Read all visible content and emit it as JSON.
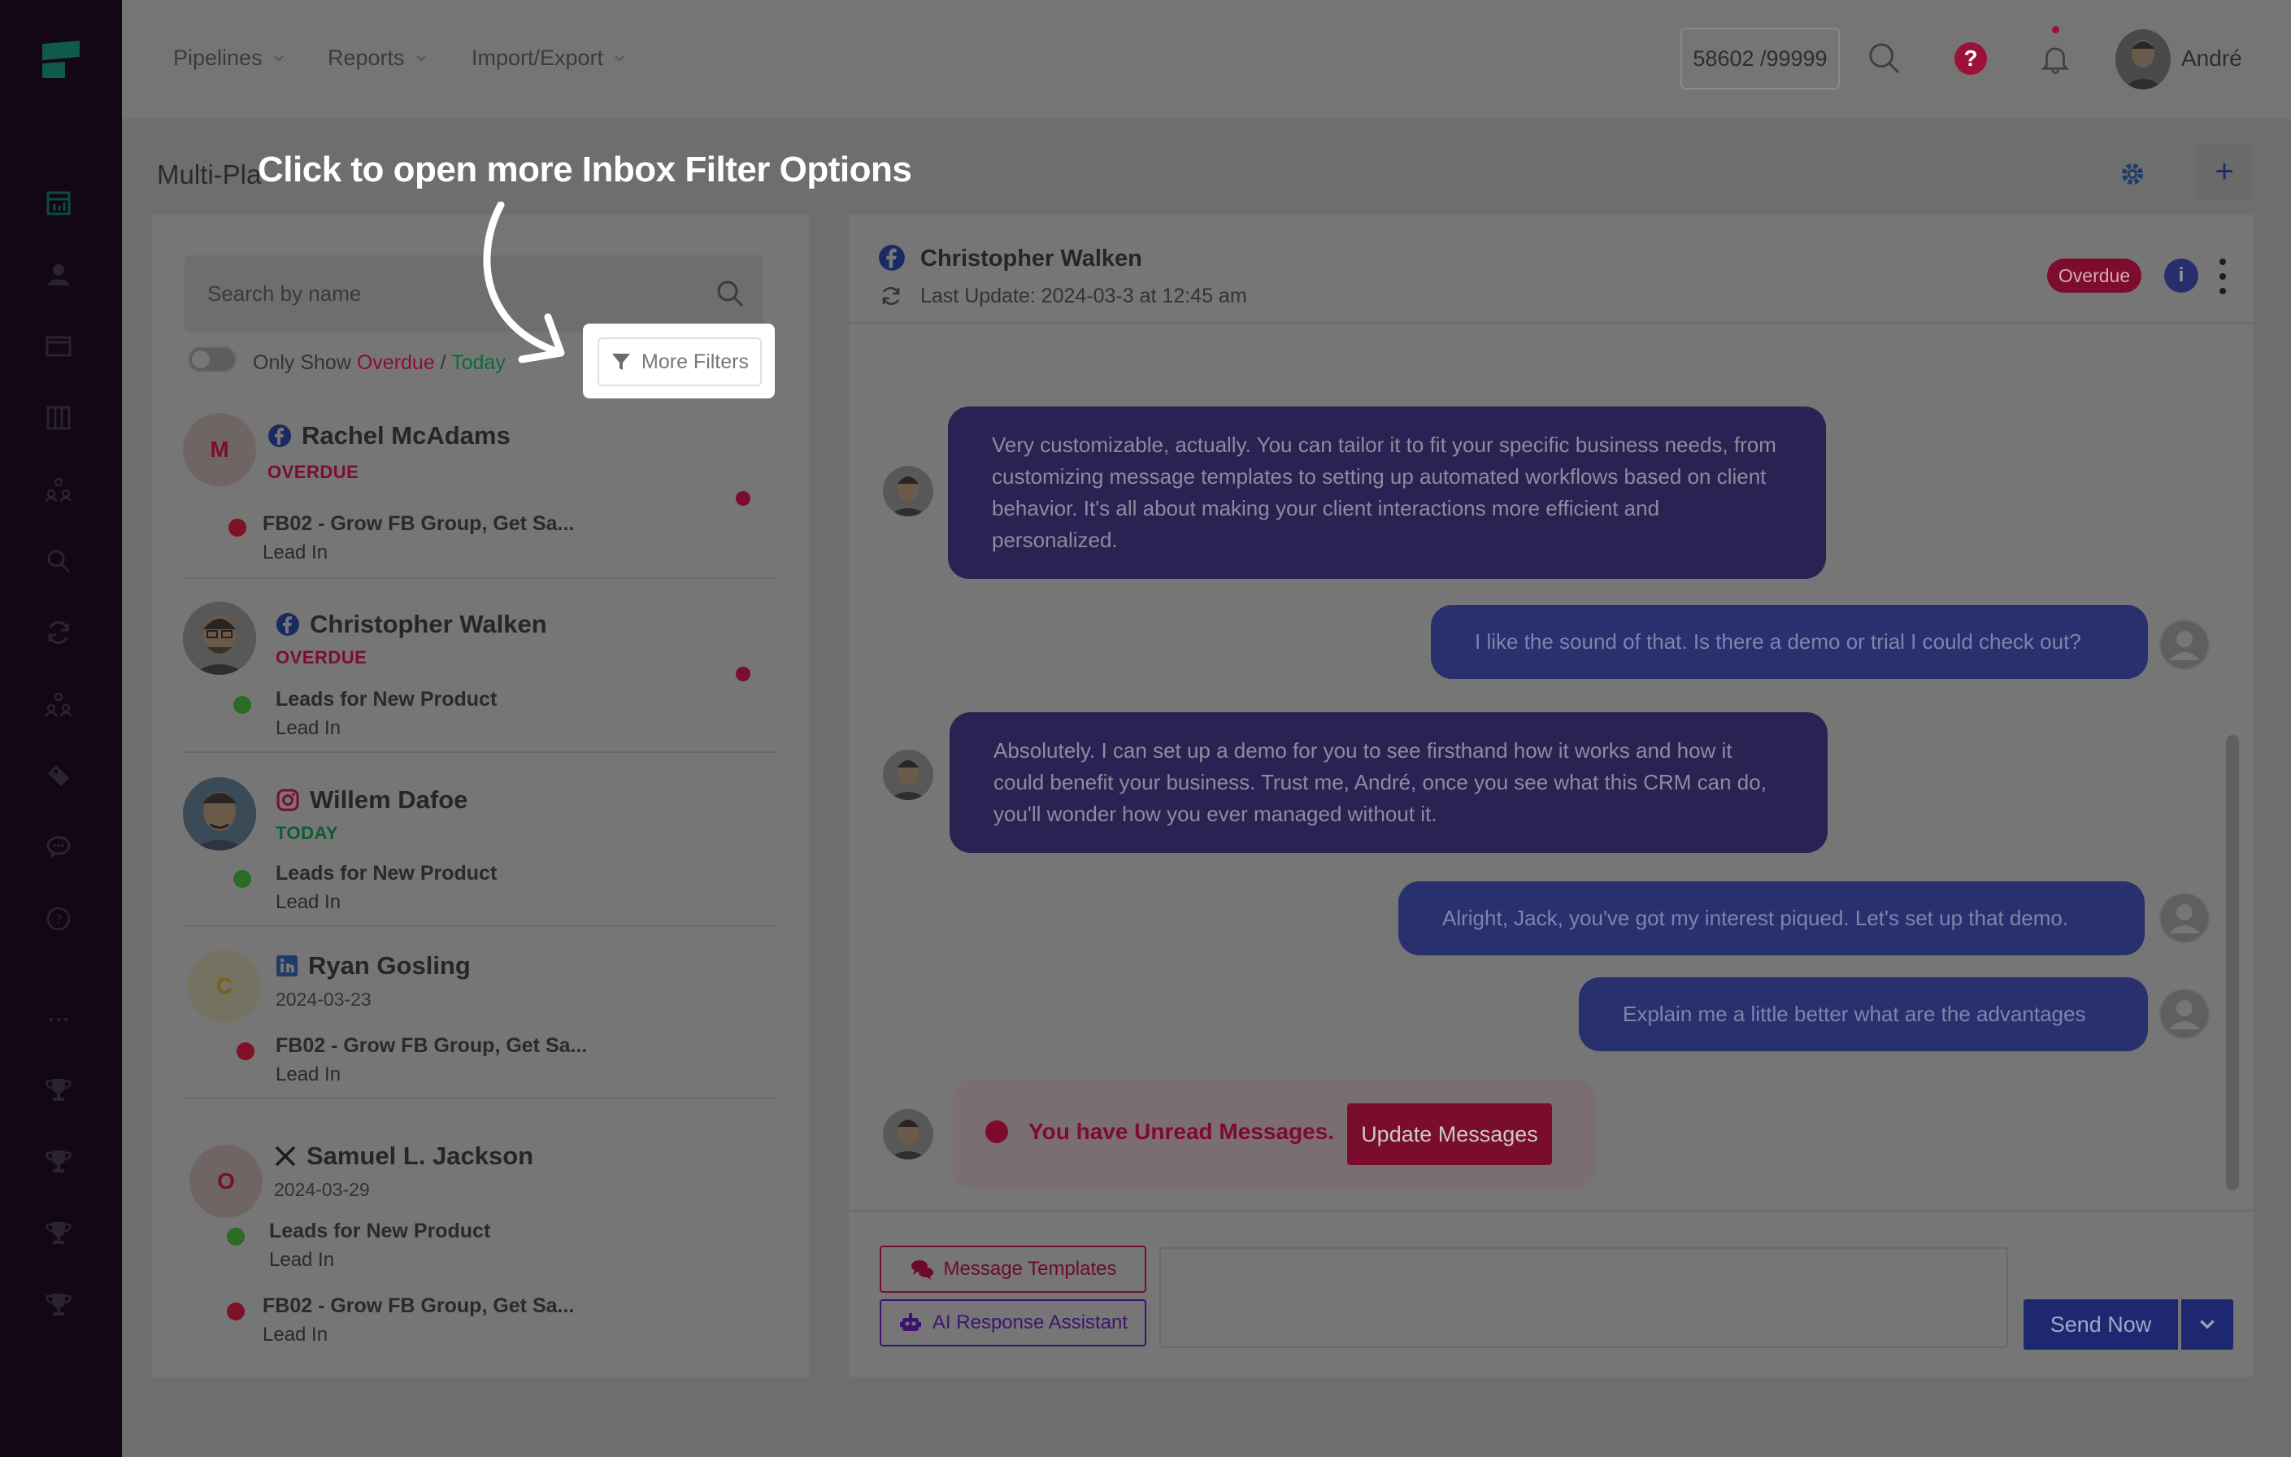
{
  "header": {
    "menus": [
      {
        "label": "Pipelines"
      },
      {
        "label": "Reports"
      },
      {
        "label": "Import/Export"
      }
    ],
    "counter": "58602 /99999",
    "help_symbol": "?",
    "user_name": "André"
  },
  "page": {
    "title": "Multi-Pla",
    "plus_symbol": "+"
  },
  "tooltip": {
    "text": "Click to open more Inbox Filter Options"
  },
  "inbox": {
    "search_placeholder": "Search by name",
    "only_show_prefix": "Only Show ",
    "only_show_overdue": "Overdue",
    "only_show_sep": " / ",
    "only_show_today": "Today",
    "more_filters_label": "More Filters",
    "contacts": [
      {
        "initial": "M",
        "name": "Rachel McAdams",
        "platform": "facebook-icon",
        "status": "OVERDUE",
        "deals": [
          {
            "title": "FB02 - Grow FB Group, Get Sa...",
            "stage": "Lead In",
            "dot": "red"
          }
        ],
        "unread": true
      },
      {
        "initial": "",
        "name": "Christopher Walken",
        "platform": "facebook-icon",
        "status": "OVERDUE",
        "deals": [
          {
            "title": "Leads for New Product",
            "stage": "Lead In",
            "dot": "green"
          }
        ],
        "unread": true
      },
      {
        "initial": "",
        "name": "Willem Dafoe",
        "platform": "instagram-icon",
        "status": "TODAY",
        "deals": [
          {
            "title": "Leads for New Product",
            "stage": "Lead In",
            "dot": "green"
          }
        ],
        "unread": false
      },
      {
        "initial": "C",
        "name": "Ryan Gosling",
        "platform": "linkedin-icon",
        "date": "2024-03-23",
        "deals": [
          {
            "title": "FB02 - Grow FB Group, Get Sa...",
            "stage": "Lead In",
            "dot": "red"
          }
        ],
        "unread": false
      },
      {
        "initial": "O",
        "name": "Samuel L. Jackson",
        "platform": "x-icon",
        "date": "2024-03-29",
        "deals": [
          {
            "title": "Leads for New Product",
            "stage": "Lead In",
            "dot": "green"
          },
          {
            "title": "FB02 - Grow FB Group, Get Sa...",
            "stage": "Lead In",
            "dot": "red"
          }
        ],
        "unread": false
      }
    ]
  },
  "chat": {
    "contact_name": "Christopher Walken",
    "last_update": "Last Update: 2024-03-3 at 12:45 am",
    "badge": "Overdue",
    "info_symbol": "i",
    "messages": [
      {
        "dir": "in",
        "text": "Very customizable, actually. You can tailor it to fit your specific business needs, from customizing message templates to setting up automated workflows based on client behavior. It's all about making your client interactions more efficient and personalized."
      },
      {
        "dir": "out",
        "text": "I like the sound of that. Is there a demo or trial I could check out?"
      },
      {
        "dir": "in",
        "text": "Absolutely. I can set up a demo for you to see firsthand how it works and how it could benefit your business. Trust me, André, once you see what this CRM can do, you'll wonder how you ever managed without it."
      },
      {
        "dir": "out",
        "text": "Alright, Jack, you've got my interest piqued. Let's set up that demo."
      },
      {
        "dir": "out",
        "text": "Explain me a little better what are the advantages"
      }
    ],
    "unread_notice": "You have Unread Messages.",
    "update_button": "Update Messages",
    "templates_button": "Message Templates",
    "ai_button": "AI Response Assistant",
    "send_button": "Send Now"
  },
  "colors": {
    "sidebar": "#120617",
    "accent_red": "#7a0c2d",
    "accent_blue": "#1e2870",
    "highlight": "#ffffff"
  }
}
